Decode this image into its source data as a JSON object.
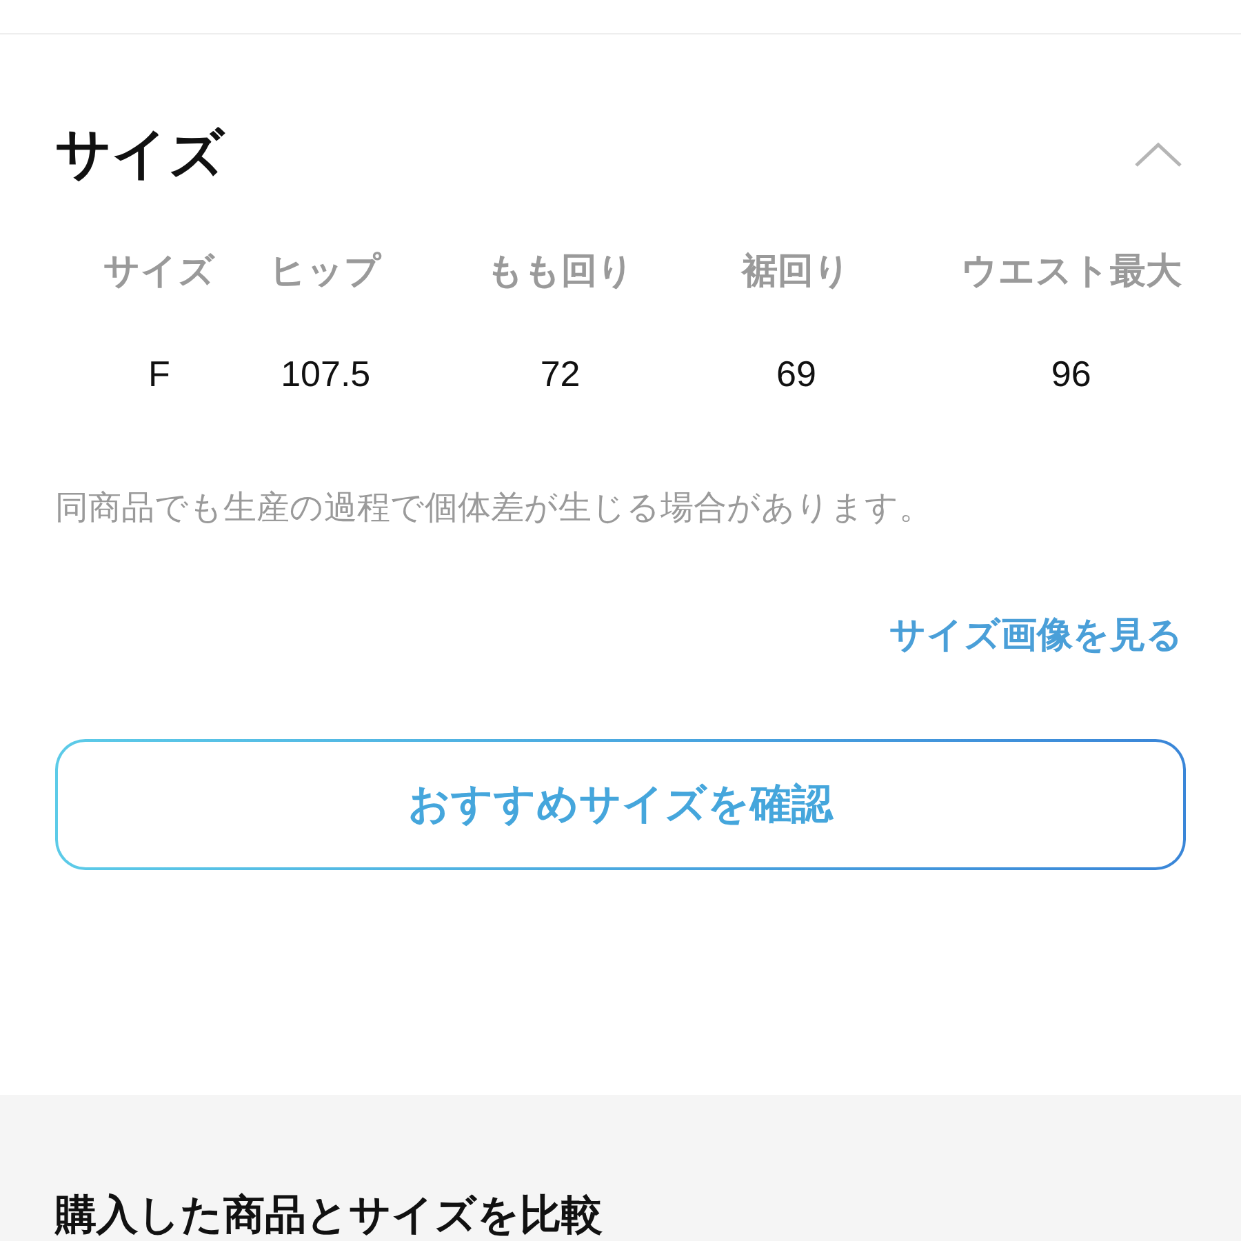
{
  "size_section": {
    "title": "サイズ",
    "expanded": true,
    "table": {
      "columns": [
        "サイズ",
        "ヒップ",
        "もも回り",
        "裾回り",
        "ウエスト最大"
      ],
      "rows": [
        [
          "F",
          "107.5",
          "72",
          "69",
          "96"
        ]
      ]
    },
    "note": "同商品でも生産の過程で個体差が生じる場合があります。",
    "link": "サイズ画像を見る",
    "button": "おすすめサイズを確認"
  },
  "compare_section": {
    "title": "購入した商品とサイズを比較"
  }
}
